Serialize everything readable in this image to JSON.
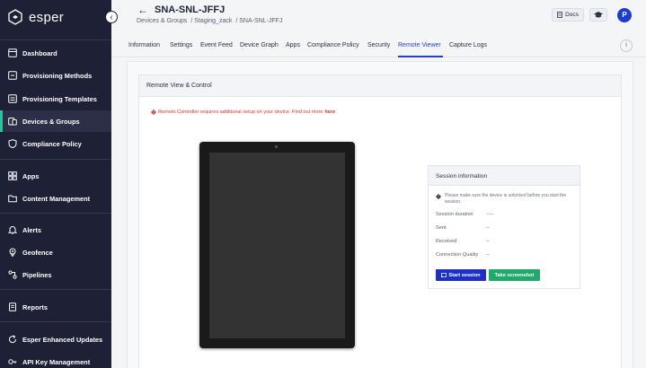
{
  "brand": {
    "name": "esper",
    "icon": "esper-logo-icon"
  },
  "sidebar": {
    "collapse_icon": "chevron-left-icon",
    "items": [
      {
        "label": "Dashboard",
        "icon": "dashboard-icon"
      },
      {
        "label": "Provisioning Methods",
        "icon": "provisioning-icon"
      },
      {
        "label": "Provisioning Templates",
        "icon": "template-icon"
      },
      {
        "label": "Devices & Groups",
        "icon": "devices-icon",
        "active": true
      },
      {
        "label": "Compliance Policy",
        "icon": "shield-icon"
      },
      {
        "label": "Apps",
        "icon": "apps-icon"
      },
      {
        "label": "Content Management",
        "icon": "folder-icon"
      },
      {
        "label": "Alerts",
        "icon": "bell-icon"
      },
      {
        "label": "Geofence",
        "icon": "map-pin-icon"
      },
      {
        "label": "Pipelines",
        "icon": "pipeline-icon"
      },
      {
        "label": "Reports",
        "icon": "reports-icon"
      },
      {
        "label": "Esper Enhanced Updates",
        "icon": "update-icon"
      },
      {
        "label": "API Key Management",
        "icon": "key-icon"
      }
    ]
  },
  "header": {
    "title": "SNA-SNL-JFFJ",
    "breadcrumbs": [
      "Devices & Groups",
      "/ Staging_zack",
      "/ SNA-SNL-JFFJ"
    ],
    "docs_label": "Docs",
    "avatar_initial": "P"
  },
  "tabs": [
    {
      "label": "Information"
    },
    {
      "label": "Settings"
    },
    {
      "label": "Event Feed"
    },
    {
      "label": "Device Graph"
    },
    {
      "label": "Apps"
    },
    {
      "label": "Compliance Policy"
    },
    {
      "label": "Security"
    },
    {
      "label": "Remote Viewer",
      "active": true
    },
    {
      "label": "Capture Logs"
    }
  ],
  "card": {
    "title": "Remote View & Control",
    "warning_text": "Remote Controller requires additional setup on your device. Find out more",
    "warning_link": "here"
  },
  "session": {
    "title": "Session information",
    "note": "Please make sure the device is unlocked before you start the session.",
    "rows": [
      {
        "key": "Session duration",
        "value": "--:--"
      },
      {
        "key": "Sent",
        "value": "--"
      },
      {
        "key": "Received",
        "value": "--"
      },
      {
        "key": "Connection Quality",
        "value": "--"
      }
    ],
    "start_label": "Start session",
    "screenshot_label": "Take screenshot"
  },
  "colors": {
    "sidebar_bg": "#1e2035",
    "active_accent": "#27c59a",
    "primary": "#1e2ec8",
    "success": "#1faa6b",
    "warning": "#e0342b",
    "tab_active": "#2b3fc1"
  }
}
